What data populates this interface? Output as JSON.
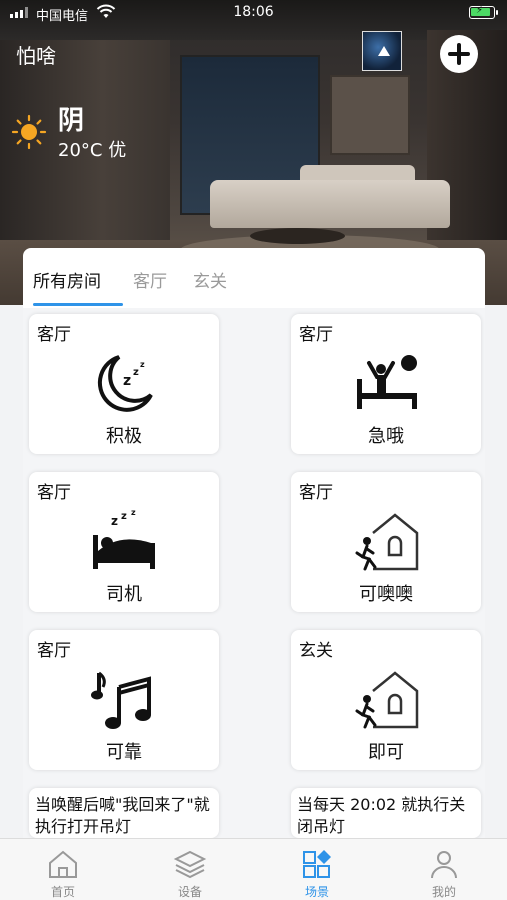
{
  "status_bar": {
    "carrier": "中国电信",
    "time": "18:06"
  },
  "header": {
    "home_name": "怕啥"
  },
  "weather": {
    "condition": "阴",
    "temp_quality": "20°C 优"
  },
  "tabs": [
    {
      "label": "所有房间",
      "active": true
    },
    {
      "label": "客厅",
      "active": false
    },
    {
      "label": "玄关",
      "active": false
    }
  ],
  "scenes": [
    {
      "room": "客厅",
      "name": "积极",
      "icon": "moon-sleep-icon"
    },
    {
      "room": "客厅",
      "name": "急哦",
      "icon": "wake-up-bed-icon"
    },
    {
      "room": "客厅",
      "name": "司机",
      "icon": "sleeping-bed-icon"
    },
    {
      "room": "客厅",
      "name": "可噢噢",
      "icon": "leave-home-icon"
    },
    {
      "room": "客厅",
      "name": "可靠",
      "icon": "music-notes-icon"
    },
    {
      "room": "玄关",
      "name": "即可",
      "icon": "leave-home-icon"
    }
  ],
  "automations": [
    {
      "desc": "当唤醒后喊\"我回来了\"就执行打开吊灯"
    },
    {
      "desc": "当每天 20:02 就执行关闭吊灯"
    }
  ],
  "bottom_nav": [
    {
      "label": "首页",
      "icon": "home-icon",
      "active": false
    },
    {
      "label": "设备",
      "icon": "devices-icon",
      "active": false
    },
    {
      "label": "场景",
      "icon": "scenes-icon",
      "active": true
    },
    {
      "label": "我的",
      "icon": "user-icon",
      "active": false
    }
  ],
  "colors": {
    "accent": "#2e93e8",
    "sun": "#f5a623"
  }
}
